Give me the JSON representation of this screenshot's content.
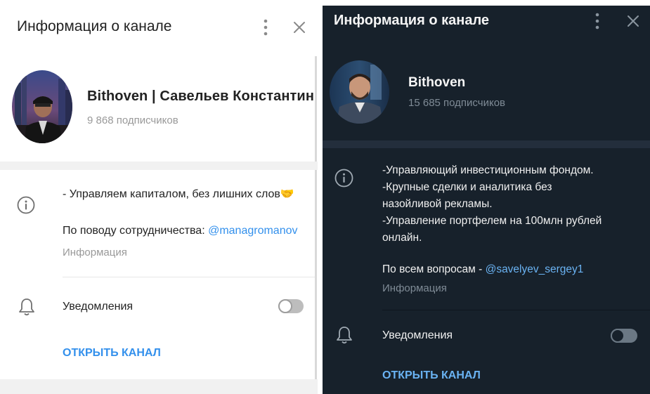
{
  "light": {
    "title": "Информация о канале",
    "name": "Bithoven | Савельев Константин",
    "subscribers": "9 868 подписчиков",
    "description_line1": "- Управляем капиталом, без лишних слов🤝",
    "cooperation_text": "По поводу сотрудничества: ",
    "cooperation_link": "@managromanov",
    "info_label": "Информация",
    "notifications_label": "Уведомления",
    "open_channel": "ОТКРЫТЬ КАНАЛ",
    "icons": [
      "more-vertical-icon",
      "close-icon",
      "info-icon",
      "bell-icon"
    ]
  },
  "dark": {
    "title": "Информация о канале",
    "name": "Bithoven",
    "subscribers": "15 685 подписчиков",
    "description_lines": [
      "-Управляющий инвестиционным фондом.",
      "-Крупные сделки и аналитика без",
      "назойливой рекламы.",
      "-Управление портфелем на 100млн рублей",
      "онлайн."
    ],
    "questions_text": "По всем вопросам - ",
    "questions_link": "@savelyev_sergey1",
    "info_label": "Информация",
    "notifications_label": "Уведомления",
    "open_channel": "ОТКРЫТЬ КАНАЛ",
    "icons": [
      "more-vertical-icon",
      "close-icon",
      "info-icon",
      "bell-icon"
    ]
  },
  "colors": {
    "accent_light": "#3390ec",
    "accent_dark": "#6ab3f3",
    "dark_bg": "#17212b"
  }
}
